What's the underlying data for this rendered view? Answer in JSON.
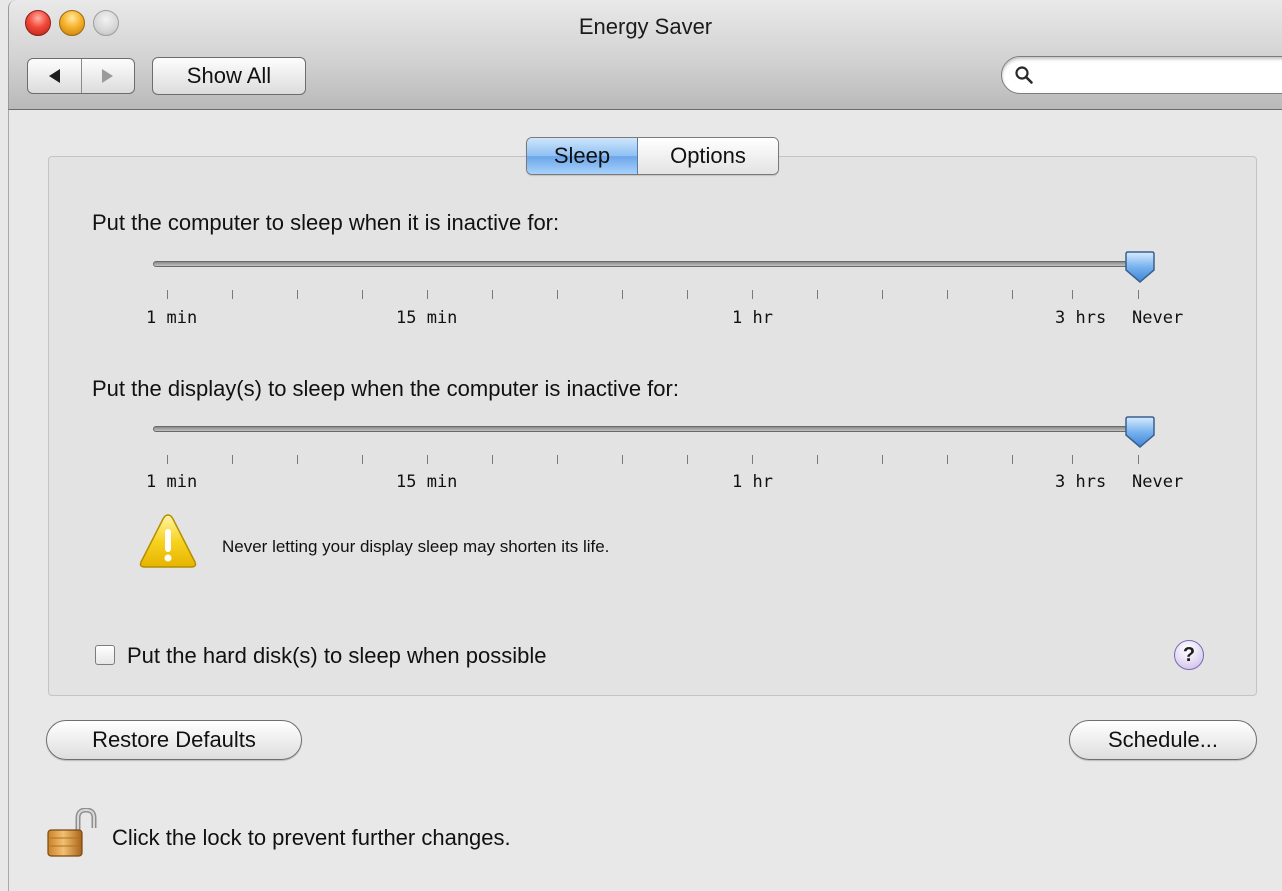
{
  "window": {
    "title": "Energy Saver",
    "toolbar": {
      "show_all_label": "Show All",
      "search_placeholder": "",
      "search_value": ""
    }
  },
  "tabs": [
    {
      "label": "Sleep",
      "selected": true
    },
    {
      "label": "Options",
      "selected": false
    }
  ],
  "computer_sleep": {
    "label": "Put the computer to sleep when it is inactive for:",
    "value": "Never",
    "tick_labels": [
      "1 min",
      "15 min",
      "1 hr",
      "3 hrs",
      "Never"
    ]
  },
  "display_sleep": {
    "label": "Put the display(s) to sleep when the computer is inactive for:",
    "value": "Never",
    "tick_labels": [
      "1 min",
      "15 min",
      "1 hr",
      "3 hrs",
      "Never"
    ]
  },
  "warning": {
    "text": "Never letting your display sleep may shorten its life.",
    "icon": "warning-triangle-icon"
  },
  "hard_disk": {
    "label": "Put the hard disk(s) to sleep when possible",
    "checked": false
  },
  "help_label": "?",
  "buttons": {
    "restore_defaults": "Restore Defaults",
    "schedule": "Schedule..."
  },
  "lock": {
    "text": "Click the lock to prevent further changes.",
    "state": "unlocked"
  },
  "colors": {
    "selected_tab": "#8ec0f3",
    "close_button": "#f2493a",
    "minimize_button": "#f7b22c",
    "warning_yellow": "#f7d320"
  }
}
